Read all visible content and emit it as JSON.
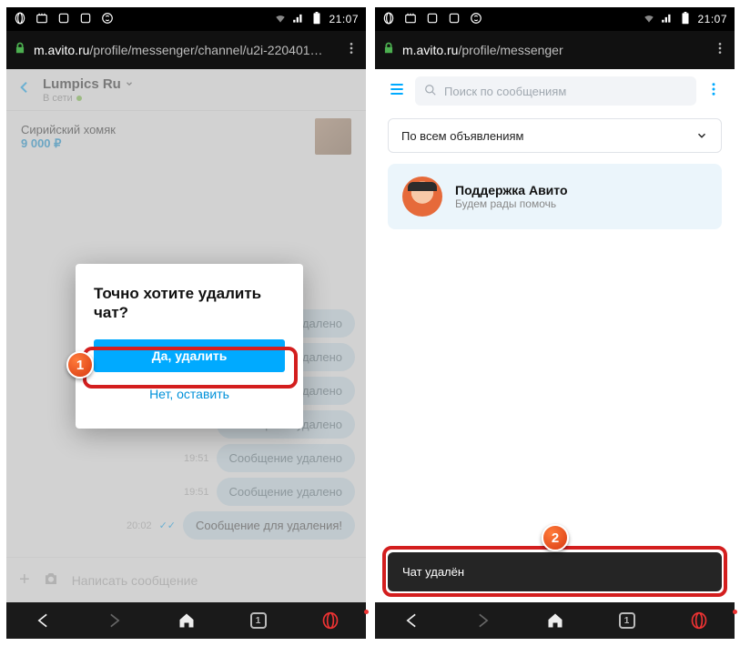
{
  "status": {
    "time": "21:07"
  },
  "browser": {
    "tabs": "1"
  },
  "left": {
    "url_domain": "m.avito.ru",
    "url_path": "/profile/messenger/channel/u2i-220401…",
    "chat": {
      "name": "Lumpics Ru",
      "status": "В сети",
      "listing_title": "Сирийский хомяк",
      "listing_price": "9 000 ₽",
      "deleted_label": "удалено",
      "msgs": [
        {
          "time": "",
          "text": "удалено"
        },
        {
          "time": "",
          "text": "удалено"
        },
        {
          "time": "",
          "text": "удалено"
        },
        {
          "time": "19:51",
          "text": "Сообщение удалено"
        },
        {
          "time": "19:51",
          "text": "Сообщение удалено"
        },
        {
          "time": "19:51",
          "text": "Сообщение удалено"
        },
        {
          "time": "20:02",
          "text": "Сообщение для удаления!"
        }
      ],
      "composer_placeholder": "Написать сообщение"
    },
    "dialog": {
      "title": "Точно хотите удалить чат?",
      "confirm": "Да, удалить",
      "cancel": "Нет, оставить"
    },
    "badge": "1"
  },
  "right": {
    "url_domain": "m.avito.ru",
    "url_path": "/profile/messenger",
    "search_placeholder": "Поиск по сообщениям",
    "filter_label": "По всем объявлениям",
    "support": {
      "title": "Поддержка Авито",
      "subtitle": "Будем рады помочь"
    },
    "toast": "Чат удалён",
    "badge": "2"
  }
}
